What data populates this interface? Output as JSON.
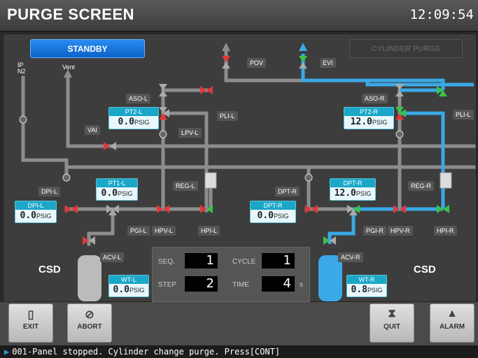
{
  "header": {
    "title": "PURGE SCREEN",
    "clock": "12:09:54"
  },
  "modes": {
    "standby": "STANDBY",
    "cylinder_purge": "CYLINDER PURGE"
  },
  "labels": {
    "ip_n2": "IP\nN2",
    "vent": "Vent",
    "pov": "POV",
    "evi": "EVI",
    "aso_l": "ASO-L",
    "aso_r": "ASO-R",
    "pli_l": "PLI-L",
    "pli_l2": "PLI-L",
    "lpv_l": "LPV-L",
    "vai": "VAI",
    "reg_l": "REG-L",
    "reg_r": "REG-R",
    "dpi_l": "DPI-L",
    "dpt_r": "DPT-R",
    "pgi_l": "PGI-L",
    "hpv_l": "HPV-L",
    "hpi_l": "HPI-L",
    "pgi_r": "PGI-R",
    "hpv_r": "HPV-R",
    "hpi_r": "HPI-R",
    "acv_l": "ACV-L",
    "acv_r": "ACV-R",
    "csd_l": "CSD",
    "csd_r": "CSD"
  },
  "gauges": {
    "pt2_l": {
      "title": "PT2-L",
      "value": "0.0",
      "unit": "PSIG"
    },
    "pt2_r": {
      "title": "PT2-R",
      "value": "12.0",
      "unit": "PSIG"
    },
    "pt1_l": {
      "title": "PT1-L",
      "value": "0.0",
      "unit": "PSIG"
    },
    "dpt_r_top": {
      "title": "DPT-R",
      "value": "12.0",
      "unit": "PSIG"
    },
    "dpi_l": {
      "title": "DPI-L",
      "value": "0.0",
      "unit": "PSIG"
    },
    "dpt_r": {
      "title": "DPT-R",
      "value": "0.0",
      "unit": "PSIG"
    },
    "wt_l": {
      "title": "WT-L",
      "value": "0.0",
      "unit": "PSIG"
    },
    "wt_r": {
      "title": "WT-R",
      "value": "0.8",
      "unit": "PSIG"
    }
  },
  "status": {
    "seq_label": "SEQ.",
    "seq": "1",
    "cycle_label": "CYCLE",
    "cycle": "1",
    "step_label": "STEP",
    "step": "2",
    "time_label": "TIME",
    "time": "4",
    "time_unit": "s"
  },
  "footer": {
    "exit": "EXIT",
    "abort": "ABORT",
    "quit": "QUIT",
    "alarm": "ALARM"
  },
  "statusbar": {
    "message": "001-Panel stopped. Cylinder change purge. Press[CONT]"
  },
  "colors": {
    "flow": "#3aa9e6",
    "pipe": "#8d8d8d",
    "valve_closed": "#e23838",
    "valve_open": "#3bc24a"
  }
}
